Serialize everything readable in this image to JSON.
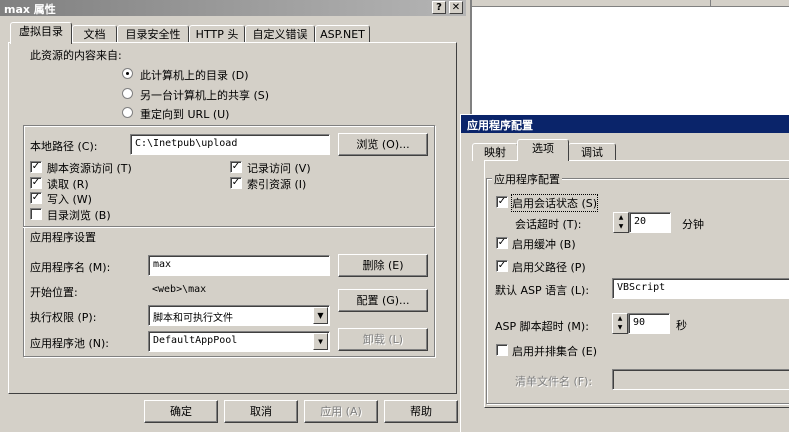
{
  "props_window": {
    "title": "max 属性",
    "help_btn": "?",
    "close_btn": "✕",
    "tabs": [
      {
        "label": "虚拟目录"
      },
      {
        "label": "文档"
      },
      {
        "label": "目录安全性"
      },
      {
        "label": "HTTP 头"
      },
      {
        "label": "自定义错误"
      },
      {
        "label": "ASP.NET"
      }
    ],
    "source_label": "此资源的内容来自:",
    "radios": [
      {
        "label": "此计算机上的目录 (D)",
        "checked": true
      },
      {
        "label": "另一台计算机上的共享 (S)",
        "checked": false
      },
      {
        "label": "重定向到 URL (U)",
        "checked": false
      }
    ],
    "local_path": {
      "label": "本地路径 (C):",
      "value": "C:\\Inetpub\\upload",
      "browse_label": "浏览 (O)..."
    },
    "checks_left": [
      {
        "label": "脚本资源访问 (T)",
        "checked": true
      },
      {
        "label": "读取 (R)",
        "checked": true
      },
      {
        "label": "写入 (W)",
        "checked": true
      },
      {
        "label": "目录浏览 (B)",
        "checked": false
      }
    ],
    "checks_right": [
      {
        "label": "记录访问 (V)",
        "checked": true
      },
      {
        "label": "索引资源 (I)",
        "checked": true
      }
    ],
    "app_settings": {
      "title": "应用程序设置",
      "name_label": "应用程序名 (M):",
      "name_value": "max",
      "remove_label": "删除 (E)",
      "start_label": "开始位置:",
      "start_value": "<web>\\max",
      "config_label": "配置 (G)...",
      "exec_label": "执行权限 (P):",
      "exec_value": "脚本和可执行文件",
      "pool_label": "应用程序池 (N):",
      "pool_value": "DefaultAppPool",
      "unload_label": "卸载 (L)"
    },
    "footer": {
      "ok": "确定",
      "cancel": "取消",
      "apply": "应用 (A)",
      "help": "帮助"
    }
  },
  "config_window": {
    "title": "应用程序配置",
    "tabs": [
      {
        "label": "映射"
      },
      {
        "label": "选项"
      },
      {
        "label": "调试"
      }
    ],
    "group_title": "应用程序配置",
    "enable_session": {
      "label": "启用会话状态 (S)",
      "checked": true
    },
    "session_timeout": {
      "label": "会话超时 (T):",
      "value": "20",
      "unit": "分钟"
    },
    "enable_buffer": {
      "label": "启用缓冲 (B)",
      "checked": true
    },
    "enable_parent": {
      "label": "启用父路径 (P)",
      "checked": true
    },
    "asp_lang": {
      "label": "默认 ASP 语言 (L):",
      "value": "VBScript"
    },
    "asp_timeout": {
      "label": "ASP 脚本超时 (M):",
      "value": "90",
      "unit": "秒"
    },
    "side_by_side": {
      "label": "启用并排集合 (E)",
      "checked": false
    },
    "manifest": {
      "label": "清单文件名 (F):",
      "value": ""
    }
  },
  "icons": {
    "check": "✓",
    "spin_up": "▲",
    "spin_down": "▼",
    "dropdown": "▼"
  }
}
